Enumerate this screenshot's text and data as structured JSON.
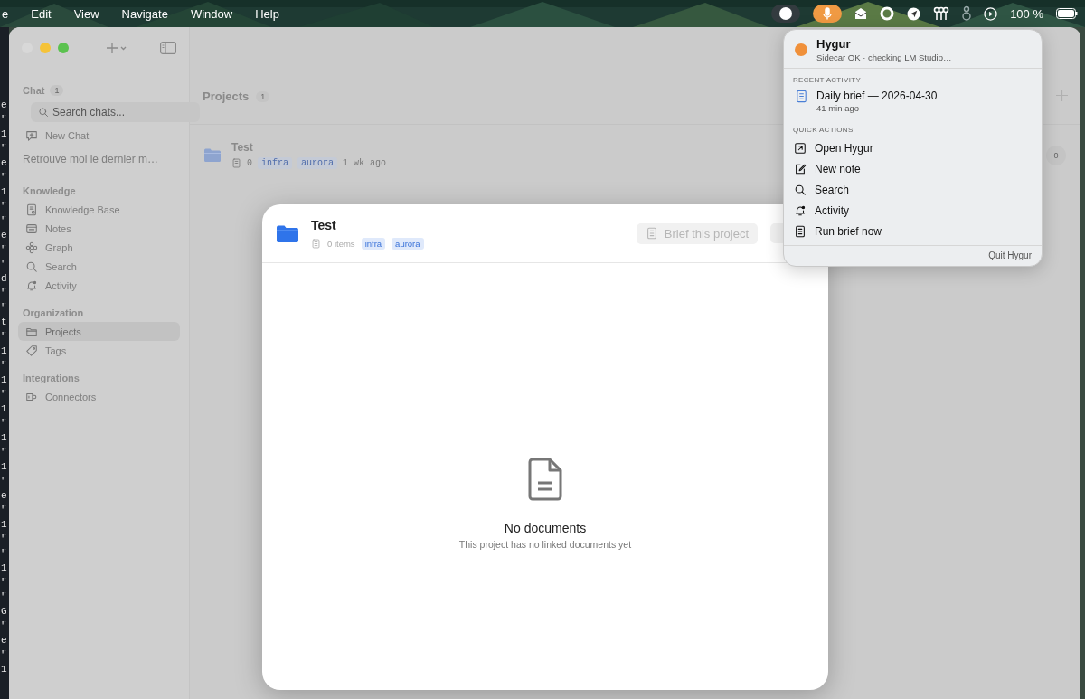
{
  "menu_bar": {
    "menus": [
      "e",
      "Edit",
      "View",
      "Navigate",
      "Window",
      "Help"
    ],
    "battery_reading": "100 %"
  },
  "terminal_edge": [
    "e",
    "\"",
    "1",
    "\"",
    "e",
    "\"",
    "1",
    "\"",
    "\"",
    "e",
    "\"",
    "\"",
    "d",
    "\"",
    "\"",
    "t",
    "\"",
    "1",
    "\"",
    "1",
    "\"",
    "1",
    "\"",
    "1",
    "\"",
    "1",
    "\"",
    "e",
    "\"",
    "1",
    "\"",
    "\"",
    "1",
    "\"",
    "\"",
    "G",
    "\"",
    "e",
    "\"",
    "1"
  ],
  "sidebar": {
    "sections": [
      {
        "title": "Chat",
        "count": "1",
        "search": {
          "placeholder": "Search chats..."
        },
        "items": [
          {
            "kind": "action",
            "label": "New Chat",
            "selected": false
          },
          {
            "kind": "chat",
            "label": "Retrouve moi le dernier m…",
            "selected": false
          }
        ]
      },
      {
        "title": "Knowledge",
        "items": [
          {
            "kind": "nav",
            "label": "Knowledge Base",
            "selected": false
          },
          {
            "kind": "nav",
            "label": "Notes",
            "selected": false
          },
          {
            "kind": "nav",
            "label": "Graph",
            "selected": false
          },
          {
            "kind": "nav",
            "label": "Search",
            "selected": false
          },
          {
            "kind": "nav",
            "label": "Activity",
            "selected": false
          }
        ]
      },
      {
        "title": "Organization",
        "items": [
          {
            "kind": "nav",
            "label": "Projects",
            "selected": true
          },
          {
            "kind": "nav",
            "label": "Tags",
            "selected": false
          }
        ]
      },
      {
        "title": "Integrations",
        "items": [
          {
            "kind": "nav",
            "label": "Connectors",
            "selected": false
          }
        ]
      }
    ]
  },
  "projects": {
    "title": "Projects",
    "count": "1",
    "rows": [
      {
        "name": "Test",
        "items": "0",
        "tags": [
          "infra",
          "aurora"
        ],
        "updated": "1 wk ago",
        "badge": "0"
      }
    ]
  },
  "modal": {
    "title": "Test",
    "items": "0 items",
    "tags": [
      "infra",
      "aurora"
    ],
    "actions": [
      {
        "label": "Brief this project",
        "disabled": true
      }
    ],
    "empty_state": {
      "title": "No documents",
      "message": "This project has no linked documents yet"
    }
  },
  "popover": {
    "app_name": "Hygur",
    "status": "Sidecar OK · checking LM Studio…",
    "recent_title": "RECENT ACTIVITY",
    "recent": [
      {
        "title": "Daily brief — 2026-04-30",
        "time": "41 min ago"
      }
    ],
    "actions_title": "QUICK ACTIONS",
    "actions": [
      {
        "label": "Open Hygur"
      },
      {
        "label": "New note"
      },
      {
        "label": "Search"
      },
      {
        "label": "Activity"
      },
      {
        "label": "Run brief now"
      }
    ],
    "quit": "Quit Hygur"
  }
}
